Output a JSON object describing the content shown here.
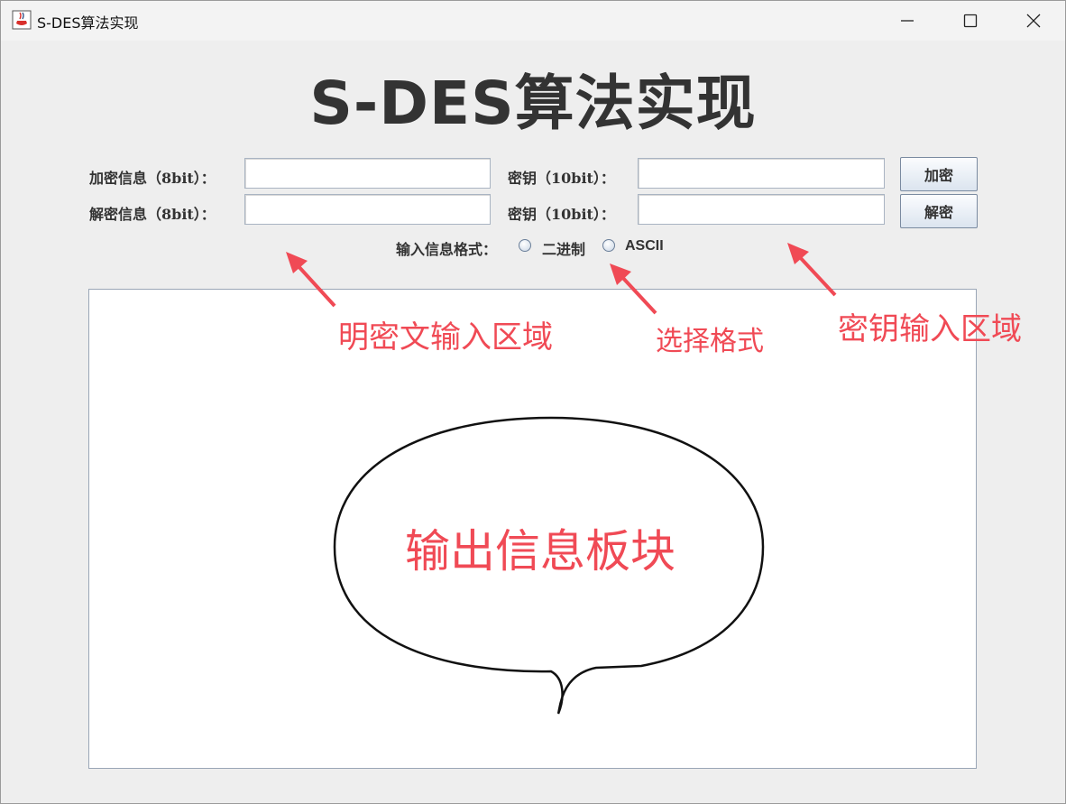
{
  "window": {
    "title": "S-DES算法实现",
    "icon": "java-coffee-cup-icon"
  },
  "heading": "S-DES算法实现",
  "encrypt_row": {
    "message_label": "加密信息（8bit）：",
    "message_value": "",
    "key_label": "密钥（10bit）：",
    "key_value": "",
    "button_label": "加密"
  },
  "decrypt_row": {
    "message_label": "解密信息（8bit）：",
    "message_value": "",
    "key_label": "密钥（10bit）：",
    "key_value": "",
    "button_label": "解密"
  },
  "format": {
    "label": "输入信息格式：",
    "options": [
      "二进制",
      "ASCII"
    ],
    "selected": null
  },
  "output": {
    "text": ""
  },
  "annotations": {
    "plaintext_area": "明密文输入区域",
    "select_format": "选择格式",
    "key_area": "密钥输入区域",
    "output_panel": "输出信息板块",
    "color": "#f04a55"
  }
}
